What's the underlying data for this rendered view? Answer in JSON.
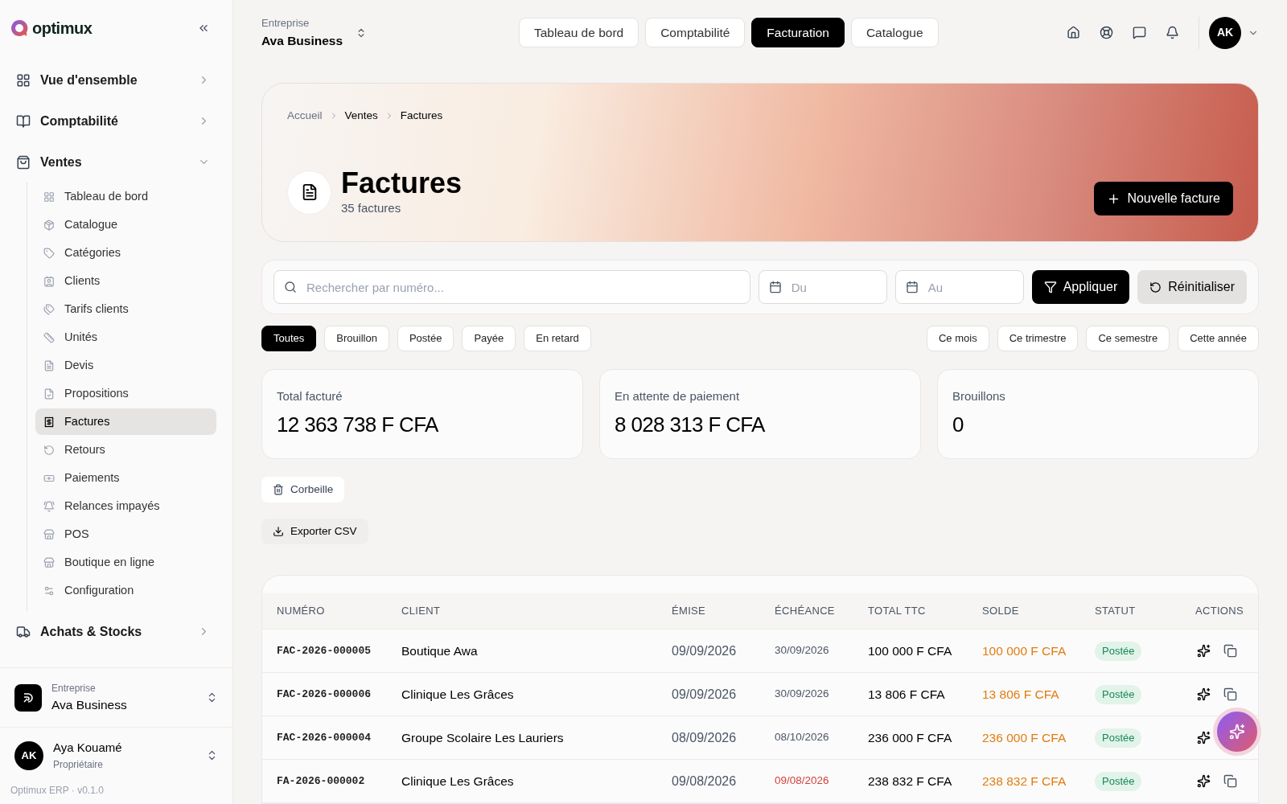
{
  "brand": {
    "name": "optimux"
  },
  "sidebar": {
    "sections": [
      {
        "label": "Vue d'ensemble",
        "expanded": false
      },
      {
        "label": "Comptabilité",
        "expanded": false
      },
      {
        "label": "Ventes",
        "expanded": true,
        "children": [
          {
            "label": "Tableau de bord",
            "selected": false
          },
          {
            "label": "Catalogue",
            "selected": false
          },
          {
            "label": "Catégories",
            "selected": false
          },
          {
            "label": "Clients",
            "selected": false
          },
          {
            "label": "Tarifs clients",
            "selected": false
          },
          {
            "label": "Unités",
            "selected": false
          },
          {
            "label": "Devis",
            "selected": false
          },
          {
            "label": "Propositions",
            "selected": false
          },
          {
            "label": "Factures",
            "selected": true
          },
          {
            "label": "Retours",
            "selected": false
          },
          {
            "label": "Paiements",
            "selected": false
          },
          {
            "label": "Relances impayés",
            "selected": false
          },
          {
            "label": "POS",
            "selected": false
          },
          {
            "label": "Boutique en ligne",
            "selected": false
          },
          {
            "label": "Configuration",
            "selected": false
          }
        ]
      },
      {
        "label": "Achats & Stocks",
        "expanded": false
      }
    ],
    "company": {
      "caption": "Entreprise",
      "name": "Ava Business"
    },
    "user": {
      "initials": "AK",
      "name": "Aya Kouamé",
      "role": "Propriétaire"
    },
    "version": "Optimux ERP · v0.1.0"
  },
  "topbar": {
    "company": {
      "caption": "Entreprise",
      "name": "Ava Business"
    },
    "tabs": [
      {
        "label": "Tableau de bord",
        "selected": false
      },
      {
        "label": "Comptabilité",
        "selected": false
      },
      {
        "label": "Facturation",
        "selected": true
      },
      {
        "label": "Catalogue",
        "selected": false
      }
    ],
    "avatar": "AK"
  },
  "hero": {
    "breadcrumb": [
      "Accueil",
      "Ventes",
      "Factures"
    ],
    "title": "Factures",
    "subtitle": "35 factures",
    "button": "Nouvelle facture"
  },
  "filters": {
    "search": {
      "placeholder": "Rechercher par numéro..."
    },
    "from": {
      "placeholder": "Du"
    },
    "to": {
      "placeholder": "Au"
    },
    "apply": "Appliquer",
    "reset": "Réinitialiser"
  },
  "status_chips": [
    {
      "label": "Toutes",
      "selected": true
    },
    {
      "label": "Brouillon",
      "selected": false
    },
    {
      "label": "Postée",
      "selected": false
    },
    {
      "label": "Payée",
      "selected": false
    },
    {
      "label": "En retard",
      "selected": false
    }
  ],
  "period_chips": [
    {
      "label": "Ce mois",
      "selected": false
    },
    {
      "label": "Ce trimestre",
      "selected": false
    },
    {
      "label": "Ce semestre",
      "selected": false
    },
    {
      "label": "Cette année",
      "selected": false
    }
  ],
  "stats": [
    {
      "label": "Total facturé",
      "value": "12 363 738 F CFA"
    },
    {
      "label": "En attente de paiement",
      "value": "8 028 313 F CFA"
    },
    {
      "label": "Brouillons",
      "value": "0"
    }
  ],
  "trash_button": "Corbeille",
  "export_button": "Exporter CSV",
  "table": {
    "columns": [
      "NUMÉRO",
      "CLIENT",
      "ÉMISE",
      "ÉCHÉANCE",
      "TOTAL TTC",
      "SOLDE",
      "STATUT",
      "ACTIONS"
    ],
    "rows": [
      {
        "number": "FAC-2026-000005",
        "client": "Boutique Awa",
        "issued": "09/09/2026",
        "due": "30/09/2026",
        "overdue": false,
        "total": "100 000 F CFA",
        "balance": "100 000 F CFA",
        "status": "Postée"
      },
      {
        "number": "FAC-2026-000006",
        "client": "Clinique Les Grâces",
        "issued": "09/09/2026",
        "due": "30/09/2026",
        "overdue": false,
        "total": "13 806 F CFA",
        "balance": "13 806 F CFA",
        "status": "Postée"
      },
      {
        "number": "FAC-2026-000004",
        "client": "Groupe Scolaire Les Lauriers",
        "issued": "08/09/2026",
        "due": "08/10/2026",
        "overdue": false,
        "total": "236 000 F CFA",
        "balance": "236 000 F CFA",
        "status": "Postée"
      },
      {
        "number": "FA-2026-000002",
        "client": "Clinique Les Grâces",
        "issued": "09/08/2026",
        "due": "09/08/2026",
        "overdue": true,
        "total": "238 832 F CFA",
        "balance": "238 832 F CFA",
        "status": "Postée"
      }
    ]
  }
}
